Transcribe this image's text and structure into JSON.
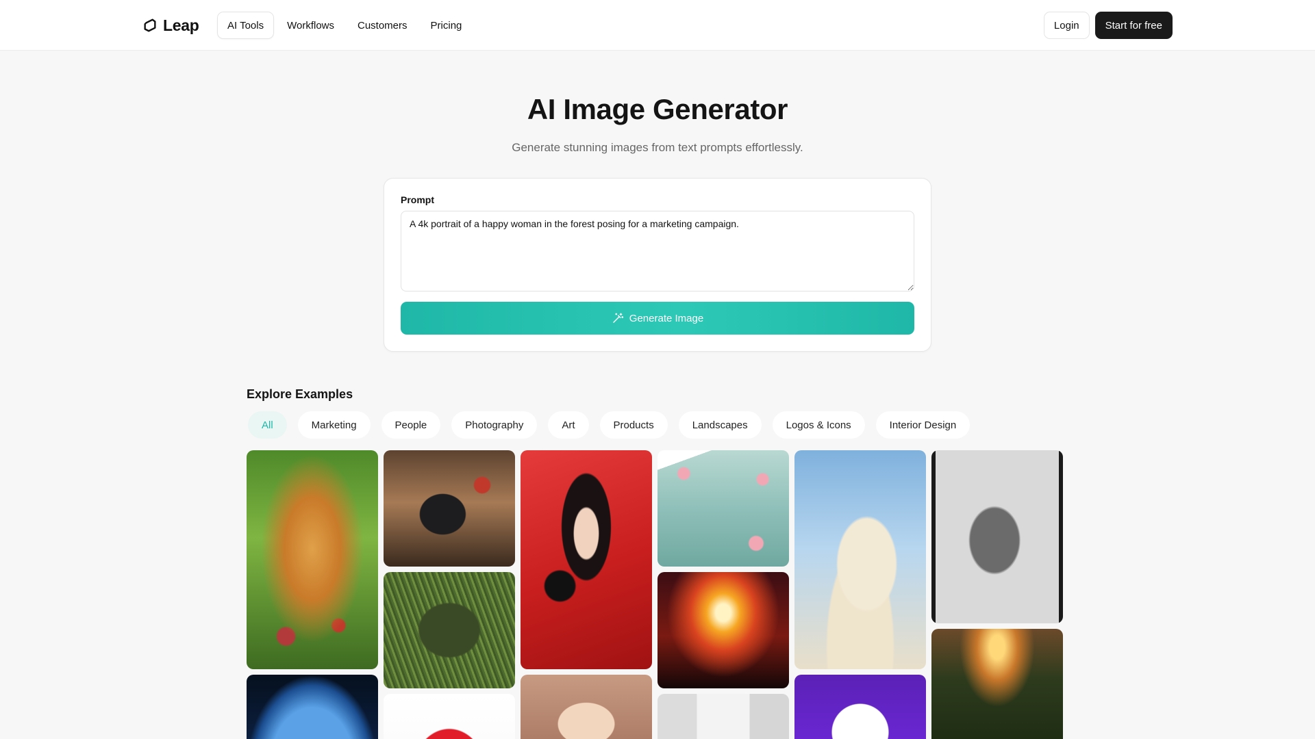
{
  "nav": {
    "logo_text": "Leap",
    "links": [
      "AI Tools",
      "Workflows",
      "Customers",
      "Pricing"
    ],
    "login": "Login",
    "start": "Start for free"
  },
  "hero": {
    "title": "AI Image Generator",
    "subtitle": "Generate stunning images from text prompts effortlessly."
  },
  "prompt": {
    "label": "Prompt",
    "value": "A 4k portrait of a happy woman in the forest posing for a marketing campaign.",
    "button": "Generate Image"
  },
  "examples": {
    "title": "Explore Examples",
    "chips": [
      "All",
      "Marketing",
      "People",
      "Photography",
      "Art",
      "Products",
      "Landscapes",
      "Logos & Icons",
      "Interior Design"
    ],
    "active_chip": "All"
  },
  "colors": {
    "accent": "#1fb8a8",
    "dark_button": "#1a1a1a"
  }
}
